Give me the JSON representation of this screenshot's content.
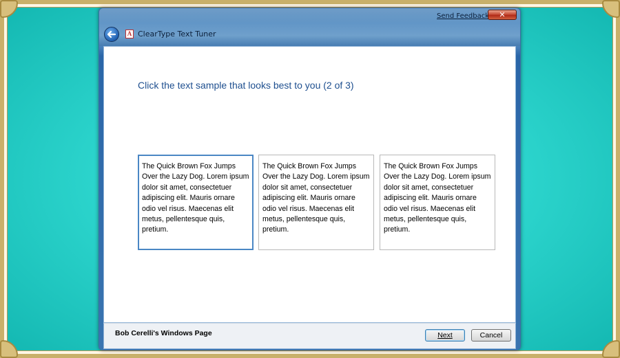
{
  "window": {
    "title": "ClearType Text Tuner",
    "send_feedback": "Send Feedback",
    "close_symbol": "✕",
    "app_icon_glyph": "A"
  },
  "main": {
    "heading": "Click the text sample that looks best to you (2 of 3)",
    "samples": [
      {
        "text": "The Quick Brown Fox Jumps Over the Lazy Dog. Lorem ipsum dolor sit amet, consectetuer adipiscing elit. Mauris ornare odio vel risus. Maecenas elit metus, pellentesque quis, pretium.",
        "selected": true
      },
      {
        "text": "The Quick Brown Fox Jumps Over the Lazy Dog. Lorem ipsum dolor sit amet, consectetuer adipiscing elit. Mauris ornare odio vel risus. Maecenas elit metus, pellentesque quis, pretium.",
        "selected": false
      },
      {
        "text": "The Quick Brown Fox Jumps Over the Lazy Dog. Lorem ipsum dolor sit amet, consectetuer adipiscing elit. Mauris ornare odio vel risus. Maecenas elit metus, pellentesque quis, pretium.",
        "selected": false
      }
    ]
  },
  "footer": {
    "label": "Bob Cerelli's Windows Page",
    "next_label": "Next",
    "cancel_label": "Cancel"
  },
  "icons": {
    "back": "back-arrow-icon",
    "app": "cleartype-icon",
    "close": "close-icon"
  },
  "colors": {
    "heading": "#1e4f8f",
    "selected_border": "#4a86c4",
    "frame_teal": "#2ed7cf",
    "frame_gold": "#c9b06a"
  }
}
